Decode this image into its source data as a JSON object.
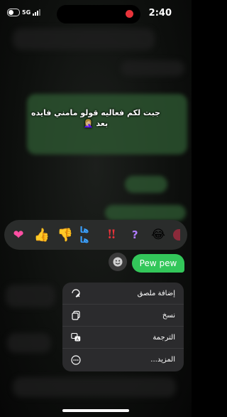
{
  "status": {
    "time": "2:40",
    "network": "5G",
    "colors": {
      "record_dot": "#e8333a"
    }
  },
  "caption": {
    "line1": "جبت لكم فعاليه قولو مامني فايده",
    "line2": "بعد 🤦🏼‍♀️"
  },
  "reactions": [
    {
      "name": "heart",
      "glyph": "❤"
    },
    {
      "name": "thumbs-up",
      "glyph": "👍"
    },
    {
      "name": "thumbs-down",
      "glyph": "👎"
    },
    {
      "name": "haha",
      "glyph": "ها ها"
    },
    {
      "name": "exclamation",
      "glyph": "‼"
    },
    {
      "name": "question",
      "glyph": "?"
    },
    {
      "name": "laugh",
      "glyph": "😂"
    }
  ],
  "message": {
    "text": "Pew pew",
    "bubble_color": "#33c75a"
  },
  "menu": {
    "items": [
      {
        "label": "إضافة ملصق",
        "icon": "sticker-icon"
      },
      {
        "label": "نسخ",
        "icon": "copy-icon"
      },
      {
        "label": "الترجمة",
        "icon": "translate-icon"
      },
      {
        "label": "المزيد...",
        "icon": "more-icon"
      }
    ]
  }
}
